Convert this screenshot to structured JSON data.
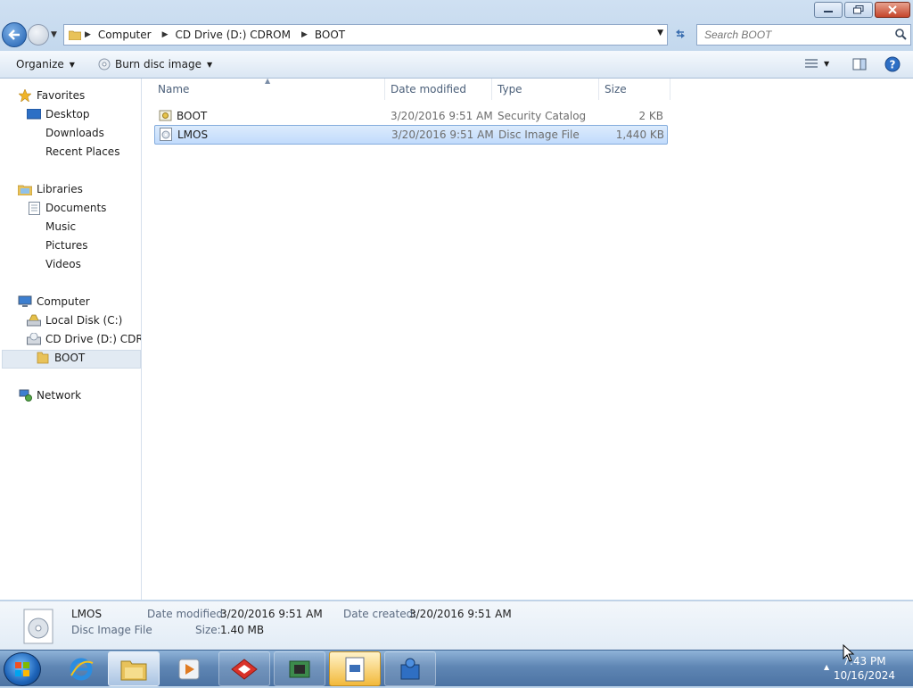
{
  "address": {
    "crumbs": [
      "Computer",
      "CD Drive (D:) CDROM",
      "BOOT"
    ]
  },
  "search": {
    "placeholder": "Search BOOT"
  },
  "toolbar": {
    "organize": "Organize",
    "burn": "Burn disc image"
  },
  "nav": {
    "favorites": "Favorites",
    "desktop": "Desktop",
    "downloads": "Downloads",
    "recent": "Recent Places",
    "libraries": "Libraries",
    "documents": "Documents",
    "music": "Music",
    "pictures": "Pictures",
    "videos": "Videos",
    "computer": "Computer",
    "local_disk": "Local Disk (C:)",
    "cd_drive": "CD Drive (D:) CDROM",
    "boot": "BOOT",
    "network": "Network"
  },
  "columns": {
    "name": "Name",
    "date": "Date modified",
    "type": "Type",
    "size": "Size"
  },
  "files": [
    {
      "name": "BOOT",
      "date": "3/20/2016 9:51 AM",
      "type": "Security Catalog",
      "size": "2 KB",
      "selected": false,
      "icon": "security-catalog-icon"
    },
    {
      "name": "LMOS",
      "date": "3/20/2016 9:51 AM",
      "type": "Disc Image File",
      "size": "1,440 KB",
      "selected": true,
      "icon": "disc-image-icon"
    }
  ],
  "details": {
    "name": "LMOS",
    "type": "Disc Image File",
    "modified_label": "Date modified:",
    "modified": "3/20/2016 9:51 AM",
    "created_label": "Date created:",
    "created": "3/20/2016 9:51 AM",
    "size_label": "Size:",
    "size": "1.40 MB"
  },
  "clock": {
    "time": "7:43 PM",
    "date": "10/16/2024"
  },
  "colors": {
    "selection": "#c1dbfc",
    "selection_border": "#84acdd",
    "taskbar": "#5f86b4"
  }
}
